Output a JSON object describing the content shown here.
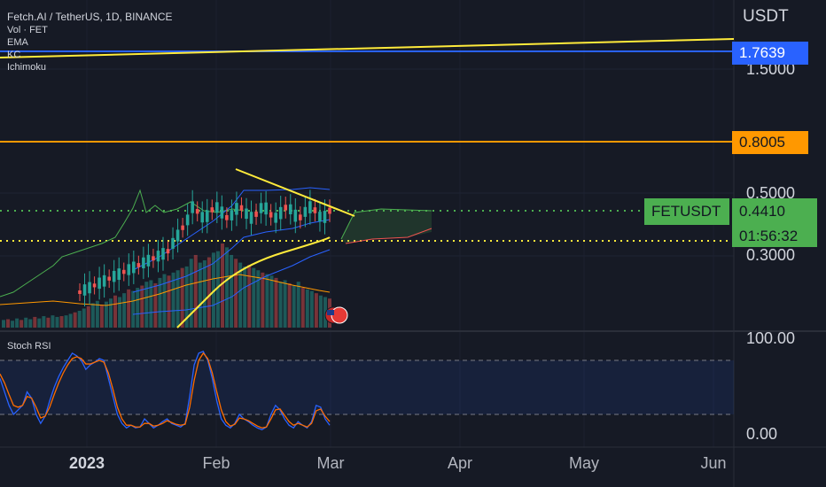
{
  "header": {
    "symbol_line": "Fetch.AI / TetherUS, 1D, BINANCE",
    "indicators": [
      "Vol · FET",
      "EMA",
      "KC",
      "Ichimoku"
    ],
    "currency": "USDT"
  },
  "price_axis": {
    "tick_labels": [
      "1.5000",
      "0.5000",
      "0.3000"
    ],
    "level_high": "1.7639",
    "level_mid": "0.8005",
    "symbol_label": "FETUSDT",
    "last_price": "0.4410",
    "countdown": "01:56:32"
  },
  "stoch_panel": {
    "title": "Stoch RSI",
    "tick_labels": [
      "100.00",
      "0.00"
    ]
  },
  "time_axis": {
    "labels": [
      "2023",
      "Feb",
      "Mar",
      "Apr",
      "May",
      "Jun"
    ]
  },
  "colors": {
    "background": "#161a25",
    "blue_level": "#2962ff",
    "orange_level": "#ff9800",
    "last_price_green": "#4caf50",
    "trendline_yellow": "#ffeb3b",
    "candle_up": "#26a69a",
    "candle_down": "#ef5350"
  },
  "icons": [
    "us-flag-event-icon"
  ],
  "chart_data": [
    {
      "type": "candlestick",
      "title": "Fetch.AI / TetherUS, 1D, BINANCE",
      "yscale": "log",
      "ylim": [
        0.1,
        2.0
      ],
      "x_range": [
        "2022-12-10",
        "2023-06-05"
      ],
      "series": [
        {
          "name": "Vol · FET",
          "kind": "volume",
          "values": [
            10,
            11,
            9,
            12,
            10,
            13,
            11,
            14,
            12,
            15,
            13,
            16,
            14,
            15,
            16,
            18,
            20,
            22,
            25,
            28,
            32,
            35,
            30,
            34,
            38,
            42,
            40,
            45,
            50,
            48,
            52,
            55,
            60,
            62,
            58,
            65,
            70,
            68,
            72,
            75,
            78,
            80,
            90,
            95,
            85,
            88,
            92,
            98,
            100,
            110,
            105,
            95,
            90,
            85,
            80,
            82,
            78,
            75,
            72,
            70,
            68,
            65,
            60,
            62,
            58,
            55,
            60,
            52,
            50,
            48,
            45,
            42,
            40,
            38
          ]
        },
        {
          "name": "EMA",
          "kind": "line"
        },
        {
          "name": "KC",
          "kind": "band"
        },
        {
          "name": "Ichimoku",
          "kind": "cloud"
        }
      ],
      "levels": [
        1.7639,
        0.8005,
        0.441
      ],
      "last_price": 0.441,
      "annotations": [
        "descending trendline",
        "ascending trendline",
        "dotted horizontal lines"
      ]
    },
    {
      "type": "line",
      "title": "Stoch RSI",
      "ylim": [
        0,
        100
      ],
      "band": [
        20,
        80
      ],
      "series": [
        {
          "kind": "K",
          "values": [
            60,
            45,
            30,
            20,
            25,
            30,
            45,
            38,
            20,
            10,
            18,
            35,
            50,
            62,
            72,
            80,
            88,
            85,
            80,
            70,
            75,
            78,
            82,
            80,
            60,
            40,
            20,
            10,
            5,
            8,
            5,
            6,
            15,
            10,
            5,
            8,
            12,
            15,
            10,
            8,
            6,
            10,
            40,
            75,
            88,
            90,
            80,
            60,
            35,
            15,
            8,
            5,
            10,
            20,
            15,
            12,
            8,
            5,
            3,
            6,
            20,
            30,
            25,
            15,
            8,
            5,
            12,
            8,
            5,
            12,
            30,
            28,
            15,
            8
          ]
        },
        {
          "kind": "D",
          "values": [
            65,
            55,
            42,
            30,
            28,
            30,
            40,
            38,
            28,
            16,
            18,
            28,
            42,
            55,
            66,
            75,
            82,
            84,
            82,
            76,
            76,
            78,
            80,
            78,
            66,
            48,
            28,
            15,
            8,
            8,
            6,
            6,
            10,
            10,
            7,
            8,
            10,
            13,
            11,
            9,
            8,
            9,
            28,
            58,
            80,
            88,
            82,
            66,
            45,
            25,
            12,
            7,
            9,
            16,
            15,
            13,
            10,
            7,
            5,
            6,
            15,
            25,
            26,
            19,
            12,
            8,
            10,
            8,
            6,
            10,
            24,
            26,
            18,
            12
          ]
        }
      ]
    }
  ]
}
